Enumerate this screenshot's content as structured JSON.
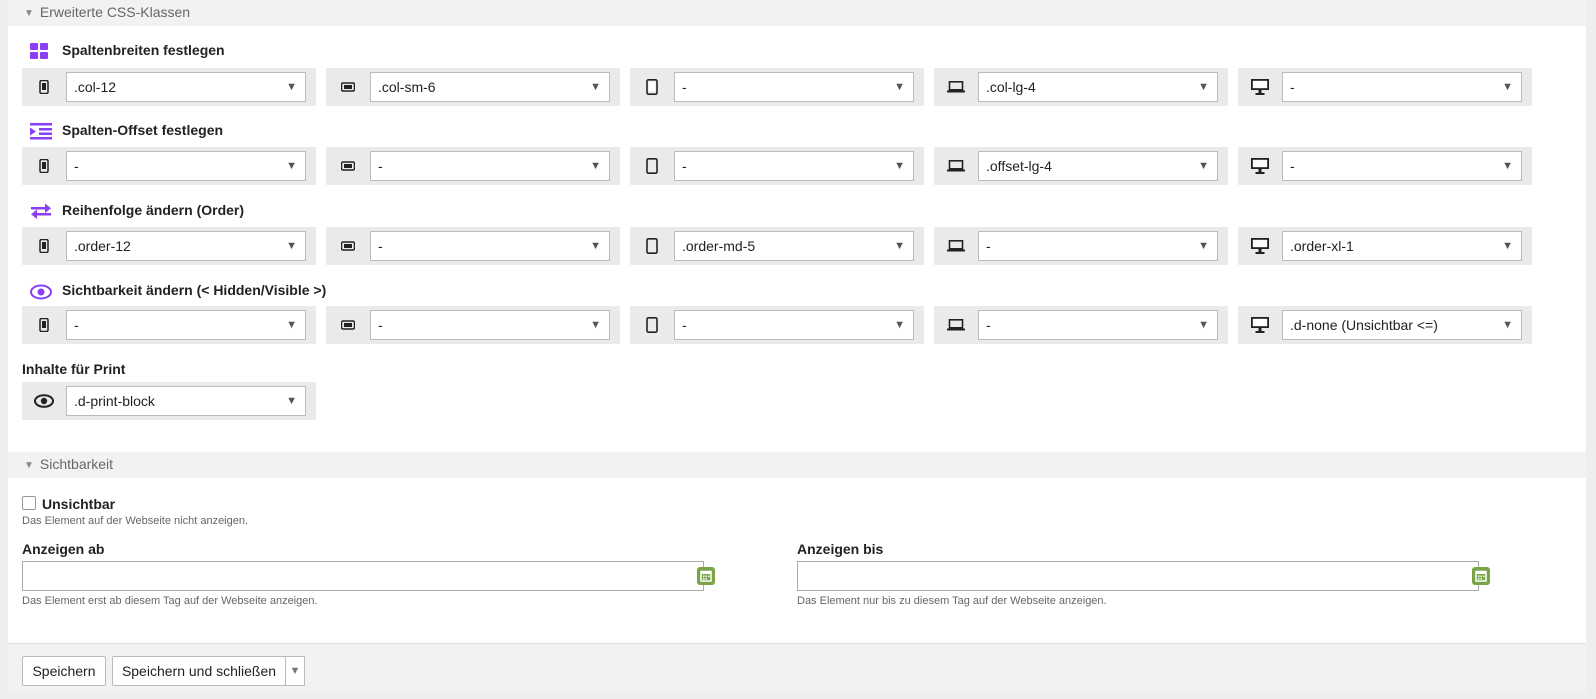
{
  "sections": {
    "css_classes_header": "Erweiterte CSS-Klassen",
    "visibility_header": "Sichtbarkeit"
  },
  "groups": [
    {
      "title": "Spaltenbreiten festlegen",
      "icon": "grid-icon",
      "values": [
        ".col-12",
        ".col-sm-6",
        "-",
        ".col-lg-4",
        "-"
      ]
    },
    {
      "title": "Spalten-Offset festlegen",
      "icon": "indent-icon",
      "values": [
        "-",
        "-",
        "-",
        ".offset-lg-4",
        "-"
      ]
    },
    {
      "title": "Reihenfolge ändern (Order)",
      "icon": "exchange-arrows-icon",
      "values": [
        ".order-12",
        "-",
        ".order-md-5",
        "-",
        ".order-xl-1"
      ]
    },
    {
      "title": "Sichtbarkeit ändern (< Hidden/Visible >)",
      "icon": "eye-icon",
      "values": [
        "-",
        "-",
        "-",
        "-",
        ".d-none (Unsichtbar <=)"
      ]
    }
  ],
  "devices": [
    "mobile-phone-icon",
    "phone-landscape-icon",
    "tablet-icon",
    "laptop-icon",
    "desktop-icon"
  ],
  "print": {
    "title": "Inhalte für Print",
    "icon": "eye-icon",
    "value": ".d-print-block"
  },
  "visibility": {
    "hidden_label": "Unsichtbar",
    "hidden_help": "Das Element auf der Webseite nicht anzeigen.",
    "start_label": "Anzeigen ab",
    "start_value": "",
    "start_help": "Das Element erst ab diesem Tag auf der Webseite anzeigen.",
    "end_label": "Anzeigen bis",
    "end_value": "",
    "end_help": "Das Element nur bis zu diesem Tag auf der Webseite anzeigen."
  },
  "footer": {
    "save": "Speichern",
    "save_close": "Speichern und schließen"
  },
  "colors": {
    "accent_purple": "#8a3ff7",
    "calendar_green": "#79a548"
  }
}
